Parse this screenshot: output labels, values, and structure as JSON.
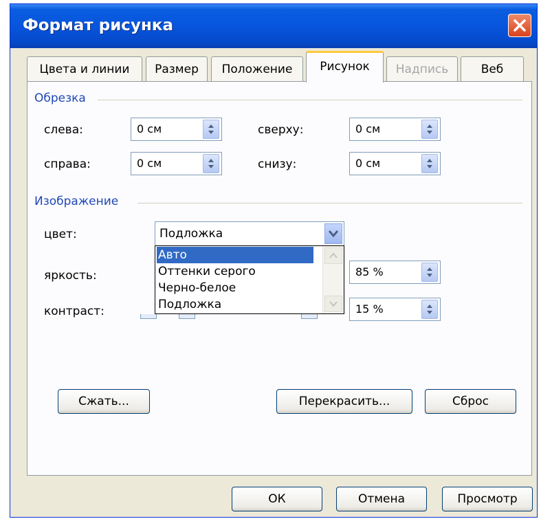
{
  "window": {
    "title": "Формат рисунка"
  },
  "tabs": [
    {
      "label": "Цвета и линии"
    },
    {
      "label": "Размер"
    },
    {
      "label": "Положение"
    },
    {
      "label": "Рисунок"
    },
    {
      "label": "Надпись"
    },
    {
      "label": "Веб"
    }
  ],
  "crop": {
    "group_label": "Обрезка",
    "left": {
      "label": "слева:",
      "value": "0 см"
    },
    "top": {
      "label": "сверху:",
      "value": "0 см"
    },
    "right": {
      "label": "справа:",
      "value": "0 см"
    },
    "bottom": {
      "label": "снизу:",
      "value": "0 см"
    }
  },
  "image": {
    "group_label": "Изображение",
    "color": {
      "label": "цвет:",
      "value": "Подложка",
      "options": [
        "Авто",
        "Оттенки серого",
        "Черно-белое",
        "Подложка"
      ]
    },
    "brightness": {
      "label": "яркость:",
      "value": "85 %"
    },
    "contrast": {
      "label": "контраст:",
      "value": "15 %"
    }
  },
  "buttons": {
    "compress": "Сжать...",
    "recolor": "Перекрасить...",
    "reset": "Сброс",
    "ok": "ОК",
    "cancel": "Отмена",
    "preview": "Просмотр"
  },
  "colors": {
    "title_bar": "#0855dd",
    "close_button": "#d8431d",
    "selection": "#316ac5",
    "group_label": "#1f48b6"
  },
  "icons": [
    "close-icon",
    "spin-arrows-icon",
    "chevron-down-icon",
    "scroll-up-icon",
    "scroll-down-icon"
  ]
}
